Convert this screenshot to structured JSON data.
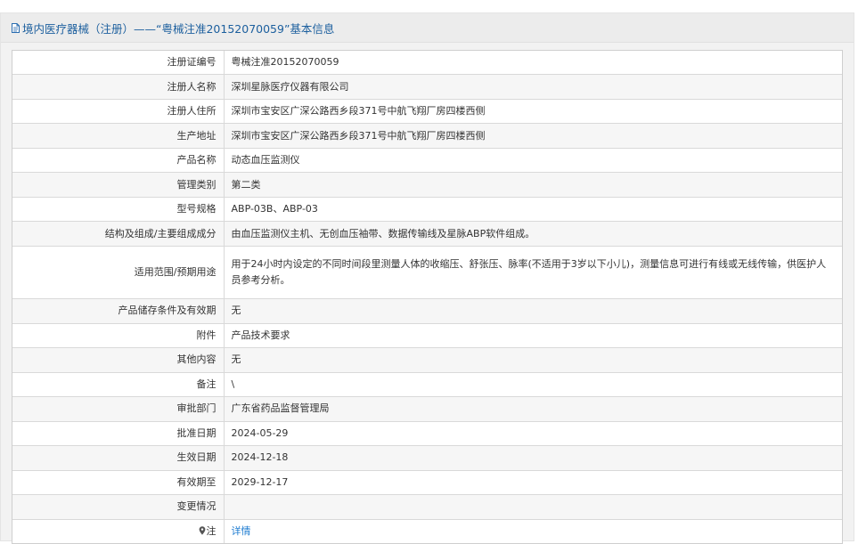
{
  "header": {
    "title": "境内医疗器械（注册）——“粤械注准20152070059”基本信息",
    "icon": "document-icon"
  },
  "rows": [
    {
      "label": "注册证编号",
      "value": "粤械注准20152070059"
    },
    {
      "label": "注册人名称",
      "value": "深圳星脉医疗仪器有限公司"
    },
    {
      "label": "注册人住所",
      "value": "深圳市宝安区广深公路西乡段371号中航飞翔厂房四楼西侧"
    },
    {
      "label": "生产地址",
      "value": "深圳市宝安区广深公路西乡段371号中航飞翔厂房四楼西侧"
    },
    {
      "label": "产品名称",
      "value": "动态血压监测仪"
    },
    {
      "label": "管理类别",
      "value": "第二类"
    },
    {
      "label": "型号规格",
      "value": "ABP-03B、ABP-03"
    },
    {
      "label": "结构及组成/主要组成成分",
      "value": "由血压监测仪主机、无创血压袖带、数据传输线及星脉ABP软件组成。"
    },
    {
      "label": "适用范围/预期用途",
      "value": "用于24小时内设定的不同时间段里测量人体的收缩压、舒张压、脉率(不适用于3岁以下小儿)，测量信息可进行有线或无线传输，供医护人员参考分析。"
    },
    {
      "label": "产品储存条件及有效期",
      "value": "无"
    },
    {
      "label": "附件",
      "value": "产品技术要求"
    },
    {
      "label": "其他内容",
      "value": "无"
    },
    {
      "label": "备注",
      "value": "\\"
    },
    {
      "label": "审批部门",
      "value": "广东省药品监督管理局"
    },
    {
      "label": "批准日期",
      "value": "2024-05-29"
    },
    {
      "label": "生效日期",
      "value": "2024-12-18"
    },
    {
      "label": "有效期至",
      "value": "2029-12-17"
    },
    {
      "label": "变更情况",
      "value": ""
    }
  ],
  "note_row": {
    "label": "注",
    "icon": "pin-icon",
    "link": "详情"
  },
  "colors": {
    "title": "#1c5f9e",
    "link": "#1c7bd0",
    "header_bg": "#ececec",
    "alt_row_bg": "#f6f6f6",
    "border": "#d9d9d9"
  }
}
